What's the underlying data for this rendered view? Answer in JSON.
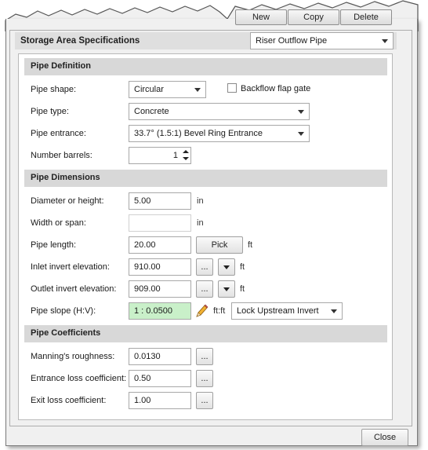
{
  "top_buttons": {
    "new": "New",
    "copy": "Copy",
    "delete": "Delete"
  },
  "header": {
    "title": "Storage Area Specifications",
    "selector_value": "Riser Outflow Pipe"
  },
  "sections": {
    "definition": "Pipe Definition",
    "dimensions": "Pipe Dimensions",
    "coefficients": "Pipe Coefficients"
  },
  "definition": {
    "shape_label": "Pipe shape:",
    "shape_value": "Circular",
    "backflow_label": "Backflow flap gate",
    "backflow_checked": false,
    "type_label": "Pipe type:",
    "type_value": "Concrete",
    "entrance_label": "Pipe entrance:",
    "entrance_value": "33.7° (1.5:1) Bevel Ring Entrance",
    "barrels_label": "Number barrels:",
    "barrels_value": "1"
  },
  "dimensions": {
    "diameter_label": "Diameter or height:",
    "diameter_value": "5.00",
    "diameter_unit": "in",
    "width_label": "Width or span:",
    "width_value": "",
    "width_unit": "in",
    "length_label": "Pipe length:",
    "length_value": "20.00",
    "pick_label": "Pick",
    "length_unit": "ft",
    "inlet_label": "Inlet invert elevation:",
    "inlet_value": "910.00",
    "inlet_unit": "ft",
    "outlet_label": "Outlet invert elevation:",
    "outlet_value": "909.00",
    "outlet_unit": "ft",
    "slope_label": "Pipe slope (H:V):",
    "slope_value": "1 : 0.0500",
    "slope_unit": "ft:ft",
    "lock_value": "Lock Upstream Invert"
  },
  "coefficients": {
    "manning_label": "Manning's roughness:",
    "manning_value": "0.0130",
    "entrance_label": "Entrance loss coefficient:",
    "entrance_value": "0.50",
    "exit_label": "Exit loss coefficient:",
    "exit_value": "1.00"
  },
  "ellipsis": "...",
  "close_label": "Close",
  "colors": {
    "slope_field": "#c9f0c9",
    "section_bg": "#d8d8d8",
    "window_bg": "#f0f0f0"
  }
}
